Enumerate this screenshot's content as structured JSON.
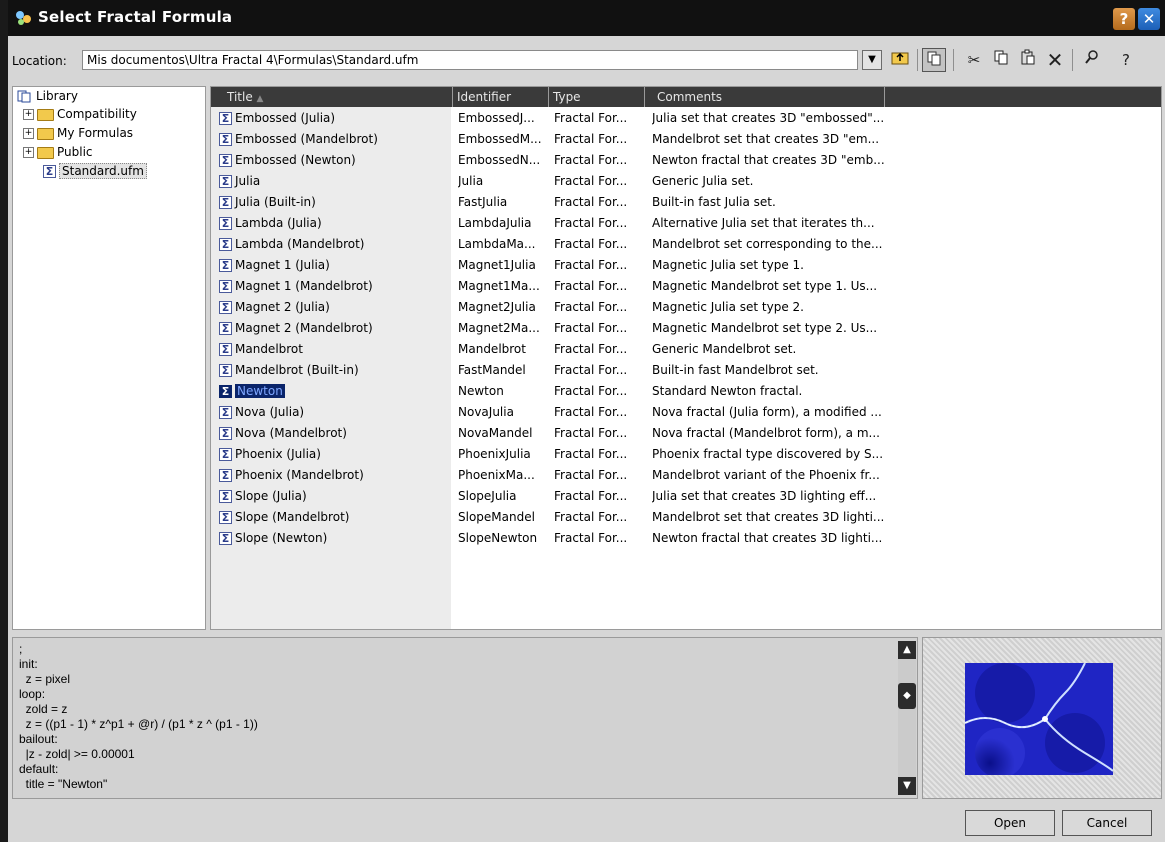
{
  "window": {
    "title": "Select Fractal Formula"
  },
  "toolbar": {
    "location_label": "Location:",
    "location_value": "Mis documentos\\Ultra Fractal 4\\Formulas\\Standard.ufm"
  },
  "tree": {
    "root": "Library",
    "folders": [
      "Compatibility",
      "My Formulas",
      "Public"
    ],
    "file": "Standard.ufm"
  },
  "list": {
    "columns": [
      "Title",
      "Identifier",
      "Type",
      "Comments"
    ],
    "rows": [
      {
        "title": "Embossed (Julia)",
        "id": "EmbossedJ...",
        "type": "Fractal For...",
        "comment": "Julia set that creates 3D \"embossed\"..."
      },
      {
        "title": "Embossed (Mandelbrot)",
        "id": "EmbossedM...",
        "type": "Fractal For...",
        "comment": "Mandelbrot set that creates 3D \"em..."
      },
      {
        "title": "Embossed (Newton)",
        "id": "EmbossedN...",
        "type": "Fractal For...",
        "comment": "Newton fractal that creates 3D \"emb..."
      },
      {
        "title": "Julia",
        "id": "Julia",
        "type": "Fractal For...",
        "comment": "Generic Julia set."
      },
      {
        "title": "Julia (Built-in)",
        "id": "FastJulia",
        "type": "Fractal For...",
        "comment": "Built-in fast Julia set."
      },
      {
        "title": "Lambda (Julia)",
        "id": "LambdaJulia",
        "type": "Fractal For...",
        "comment": "Alternative Julia set that iterates th..."
      },
      {
        "title": "Lambda (Mandelbrot)",
        "id": "LambdaMa...",
        "type": "Fractal For...",
        "comment": "Mandelbrot set corresponding to the..."
      },
      {
        "title": "Magnet 1 (Julia)",
        "id": "Magnet1Julia",
        "type": "Fractal For...",
        "comment": "Magnetic Julia set type 1."
      },
      {
        "title": "Magnet 1 (Mandelbrot)",
        "id": "Magnet1Ma...",
        "type": "Fractal For...",
        "comment": "Magnetic Mandelbrot set type 1. Us..."
      },
      {
        "title": "Magnet 2 (Julia)",
        "id": "Magnet2Julia",
        "type": "Fractal For...",
        "comment": "Magnetic Julia set type 2."
      },
      {
        "title": "Magnet 2 (Mandelbrot)",
        "id": "Magnet2Ma...",
        "type": "Fractal For...",
        "comment": "Magnetic Mandelbrot set type 2. Us..."
      },
      {
        "title": "Mandelbrot",
        "id": "Mandelbrot",
        "type": "Fractal For...",
        "comment": "Generic Mandelbrot set."
      },
      {
        "title": "Mandelbrot (Built-in)",
        "id": "FastMandel",
        "type": "Fractal For...",
        "comment": "Built-in fast Mandelbrot set."
      },
      {
        "title": "Newton",
        "id": "Newton",
        "type": "Fractal For...",
        "comment": "Standard Newton fractal.",
        "selected": true
      },
      {
        "title": "Nova (Julia)",
        "id": "NovaJulia",
        "type": "Fractal For...",
        "comment": "Nova fractal (Julia form), a modified ..."
      },
      {
        "title": "Nova (Mandelbrot)",
        "id": "NovaMandel",
        "type": "Fractal For...",
        "comment": "Nova fractal (Mandelbrot form), a m..."
      },
      {
        "title": "Phoenix (Julia)",
        "id": "PhoenixJulia",
        "type": "Fractal For...",
        "comment": "Phoenix fractal type discovered by S..."
      },
      {
        "title": "Phoenix (Mandelbrot)",
        "id": "PhoenixMa...",
        "type": "Fractal For...",
        "comment": "Mandelbrot variant of the Phoenix fr..."
      },
      {
        "title": "Slope (Julia)",
        "id": "SlopeJulia",
        "type": "Fractal For...",
        "comment": "Julia set that creates 3D lighting eff..."
      },
      {
        "title": "Slope (Mandelbrot)",
        "id": "SlopeMandel",
        "type": "Fractal For...",
        "comment": "Mandelbrot set that creates 3D lighti..."
      },
      {
        "title": "Slope (Newton)",
        "id": "SlopeNewton",
        "type": "Fractal For...",
        "comment": "Newton fractal that creates 3D lighti..."
      }
    ]
  },
  "code": {
    "lines": [
      ";",
      "init:",
      "  z = pixel",
      "loop:",
      "  zold = z",
      "  z = ((p1 - 1) * z^p1 + @r) / (p1 * z ^ (p1 - 1))",
      "bailout:",
      "  |z - zold| >= 0.00001",
      "default:",
      "  title = \"Newton\""
    ]
  },
  "buttons": {
    "open": "Open",
    "cancel": "Cancel"
  },
  "icons": [
    "formula-sigma-icon",
    "folder-icon",
    "library-icon",
    "up-folder-icon",
    "view-icon",
    "cut-icon",
    "copy-icon",
    "paste-icon",
    "delete-icon",
    "find-icon",
    "help-icon",
    "close-icon"
  ],
  "colors": {
    "titlebar": "#111111",
    "selection": "#0a246a",
    "header": "#3a3a3a",
    "preview_blue": "#1a1fb8"
  }
}
